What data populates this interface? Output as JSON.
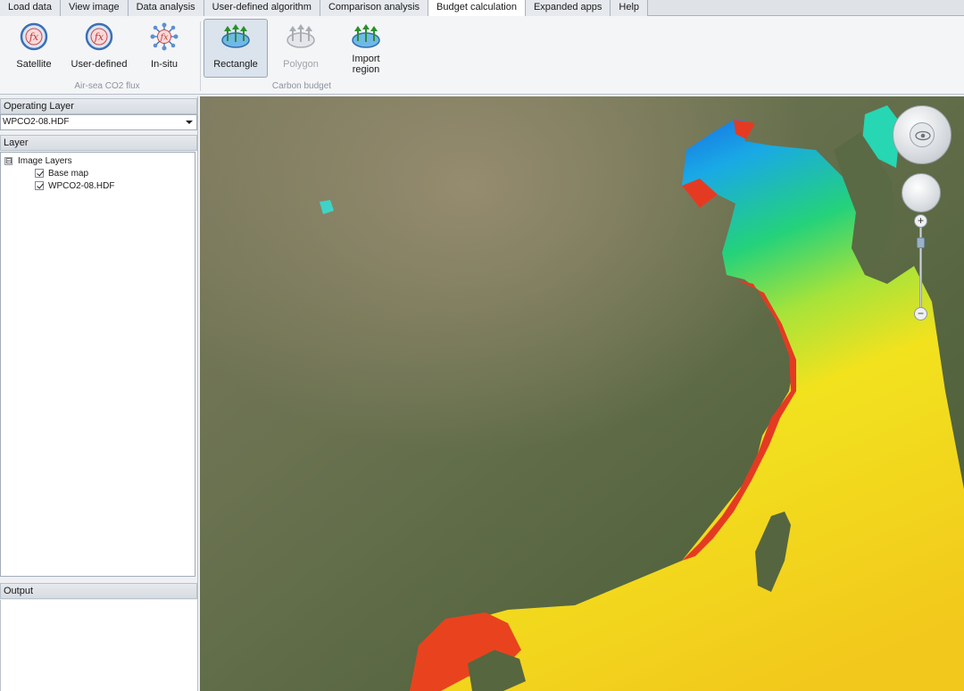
{
  "tabs": [
    {
      "label": "Load data",
      "active": false
    },
    {
      "label": "View image",
      "active": false
    },
    {
      "label": "Data analysis",
      "active": false
    },
    {
      "label": "User-defined algorithm",
      "active": false
    },
    {
      "label": "Comparison analysis",
      "active": false
    },
    {
      "label": "Budget calculation",
      "active": true
    },
    {
      "label": "Expanded apps",
      "active": false
    },
    {
      "label": "Help",
      "active": false
    }
  ],
  "ribbon": {
    "flux_group": {
      "label": "Air-sea CO2 flux",
      "buttons": [
        {
          "label": "Satellite",
          "icon": "fx-icon"
        },
        {
          "label": "User-defined",
          "icon": "fx-icon"
        },
        {
          "label": "In-situ",
          "icon": "fx-network-icon"
        }
      ]
    },
    "budget_group": {
      "label": "Carbon budget",
      "buttons": [
        {
          "label": "Rectangle",
          "icon": "rectangle-region-icon",
          "selected": true
        },
        {
          "label": "Polygon",
          "icon": "polygon-region-icon",
          "disabled": true
        },
        {
          "label": "Import region",
          "icon": "import-region-icon"
        }
      ]
    }
  },
  "left_panel": {
    "operating_layer_header": "Operating Layer",
    "operating_layer_value": "WPCO2-08.HDF",
    "layer_header": "Layer",
    "tree": {
      "root": "Image Layers",
      "root_expander": "⊟",
      "children": [
        {
          "label": "Base map",
          "checked": true
        },
        {
          "label": "WPCO2-08.HDF",
          "checked": true
        }
      ]
    },
    "output_header": "Output"
  },
  "map": {
    "zoom_in": "+",
    "zoom_out": "−",
    "colors": {
      "land": "#5f6b48",
      "sea_high": "#f2d21a",
      "sea_mid": "#7fe03a",
      "sea_low": "#1a49e0",
      "coast": "#e8331e"
    }
  }
}
